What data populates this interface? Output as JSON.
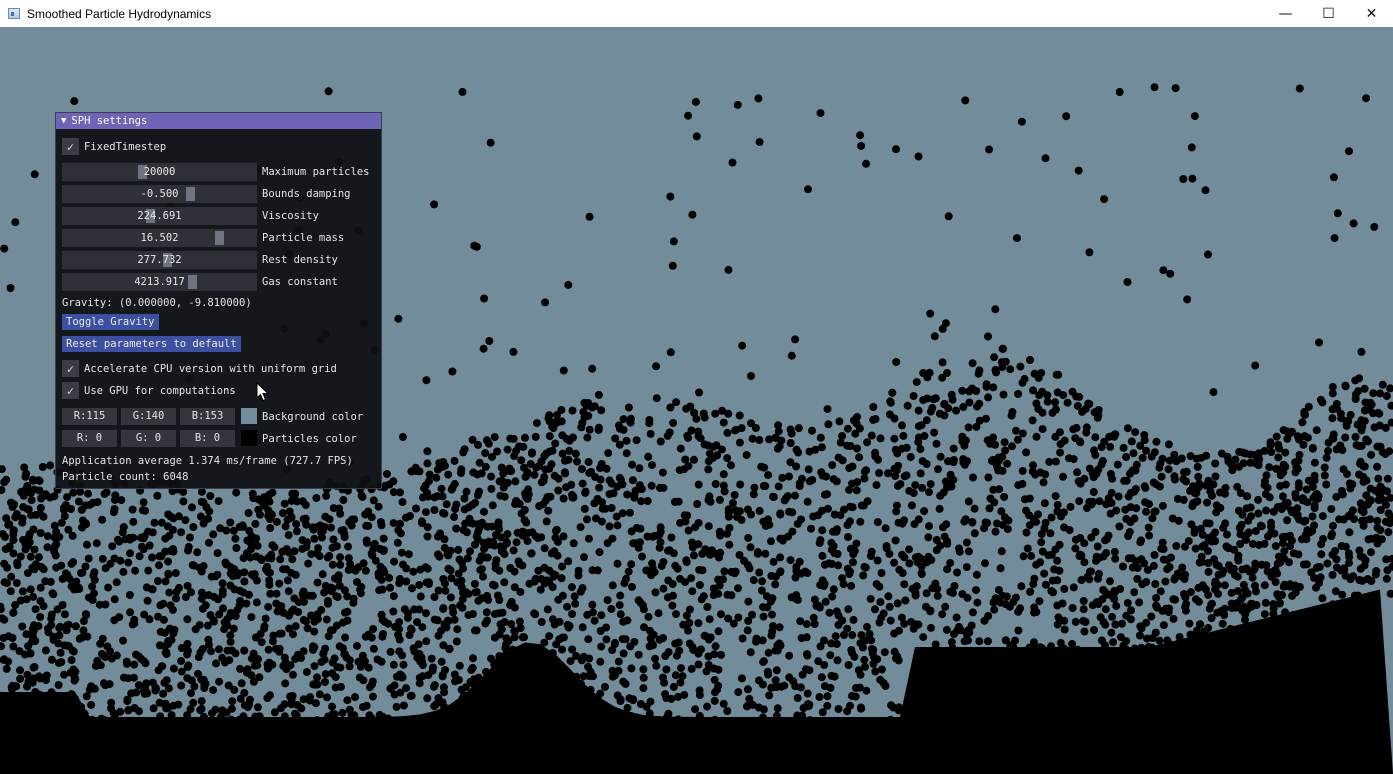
{
  "window": {
    "title": "Smoothed Particle Hydrodynamics",
    "minimize_icon": "minimize-icon",
    "maximize_icon": "maximize-icon",
    "close_icon": "close-icon",
    "minimize_glyph": "—",
    "maximize_glyph": "☐",
    "close_glyph": "✕"
  },
  "scene": {
    "background_color": "#738c99",
    "particle_color": "#000000"
  },
  "panel": {
    "title": "SPH settings",
    "collapse_glyph": "▼",
    "check_glyph": "✓",
    "fixed_timestep_label": "FixedTimestep",
    "fixed_timestep_checked": true,
    "sliders": [
      {
        "value": "20000",
        "label": "Maximum particles"
      },
      {
        "value": "-0.500",
        "label": "Bounds damping"
      },
      {
        "value": "224.691",
        "label": "Viscosity"
      },
      {
        "value": "16.502",
        "label": "Particle mass"
      },
      {
        "value": "277.732",
        "label": "Rest density"
      },
      {
        "value": "4213.917",
        "label": "Gas constant"
      }
    ],
    "gravity_text": "Gravity: (0.000000, -9.810000)",
    "toggle_gravity_label": "Toggle Gravity",
    "reset_label": "Reset parameters to default",
    "accelerate_cpu_label": "Accelerate CPU version with uniform grid",
    "accelerate_cpu_checked": true,
    "use_gpu_label": "Use GPU for computations",
    "use_gpu_checked": true,
    "background_color": {
      "r": "R:115",
      "g": "G:140",
      "b": "B:153",
      "label": "Background color",
      "swatch": "#738c99"
    },
    "particles_color": {
      "r": "R:  0",
      "g": "G:  0",
      "b": "B:  0",
      "label": "Particles color",
      "swatch": "#000000"
    },
    "app_average": "Application average 1.374 ms/frame (727.7 FPS)",
    "particle_count": "Particle count: 6048"
  }
}
